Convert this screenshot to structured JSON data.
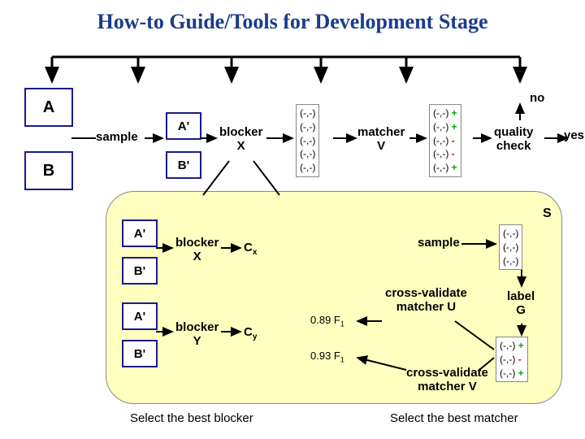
{
  "title": "How-to Guide/Tools for Development Stage",
  "boxes": {
    "A": "A",
    "B": "B",
    "Ap1": "A'",
    "Bp1": "B'",
    "Ap2": "A'",
    "Bp2": "B'",
    "Ap3": "A'",
    "Bp3": "B'"
  },
  "labels": {
    "sample1": "sample",
    "blockerX1": "blocker\nX",
    "matcherV": "matcher\nV",
    "quality": "quality\ncheck",
    "no": "no",
    "yes": "yes",
    "blockerX2": "blocker\nX",
    "blockerY": "blocker\nY",
    "Cx": "C",
    "Cx_sub": "x",
    "Cy": "C",
    "Cy_sub": "y",
    "sample2": "sample",
    "cvU": "cross-validate\nmatcher U",
    "cvV": "cross-validate\nmatcher V",
    "f1_u": "0.89 F",
    "f1_u_sub": "1",
    "f1_v": "0.93 F",
    "f1_v_sub": "1",
    "labelG": "label\nG",
    "S": "S",
    "selBlocker": "Select the best blocker",
    "selMatcher": "Select the best matcher"
  },
  "pairs": {
    "plain5": "(-,-)\n(-,-)\n(-,-)\n(-,-)\n(-,-)",
    "signed5": [
      {
        "t": "(-,-)",
        "s": "+"
      },
      {
        "t": "(-,-)",
        "s": "+"
      },
      {
        "t": "(-,-)",
        "s": "-"
      },
      {
        "t": "(-,-)",
        "s": "-"
      },
      {
        "t": "(-,-)",
        "s": "+"
      }
    ],
    "plain3": "(-,-)\n(-,-)\n(-,-)",
    "signed3": [
      {
        "t": "(-,-)",
        "s": "+"
      },
      {
        "t": "(-,-)",
        "s": "-"
      },
      {
        "t": "(-,-)",
        "s": "+"
      }
    ]
  }
}
